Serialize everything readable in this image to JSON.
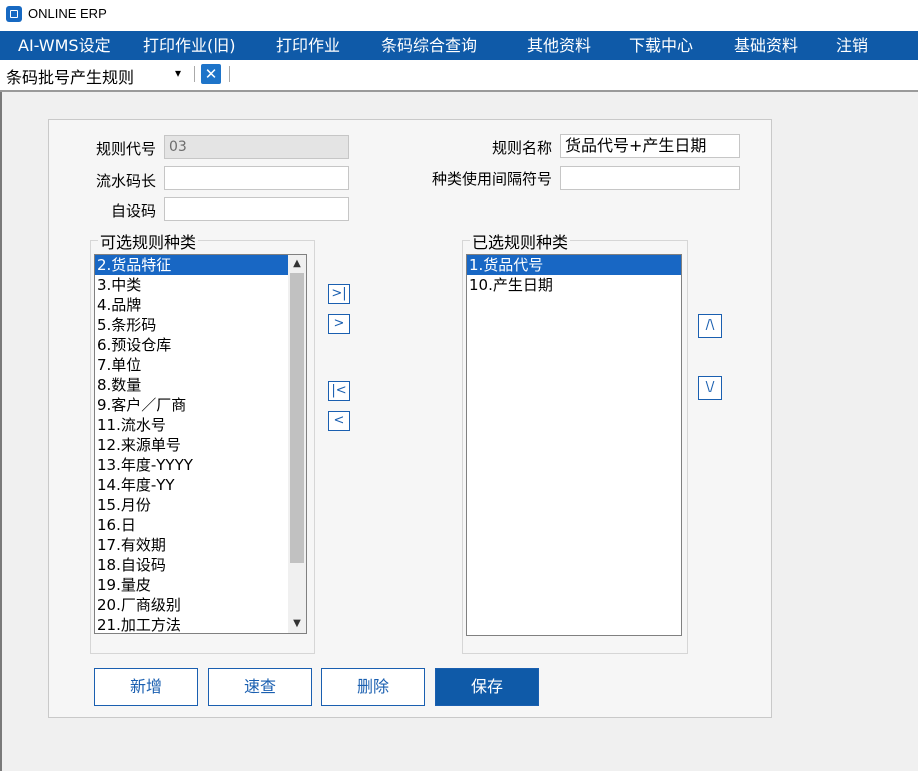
{
  "app": {
    "title": "ONLINE ERP"
  },
  "menu": [
    {
      "label": "AI-WMS设定"
    },
    {
      "label": "打印作业(旧)"
    },
    {
      "label": "打印作业"
    },
    {
      "label": "条码综合查询"
    },
    {
      "label": "其他资料"
    },
    {
      "label": "下载中心"
    },
    {
      "label": "基础资料"
    },
    {
      "label": "注销"
    }
  ],
  "tab": {
    "label": "条码批号产生规则",
    "caret": "▾",
    "close": "✕"
  },
  "form": {
    "rule_code_label": "规则代号",
    "rule_code_value": "03",
    "rule_name_label": "规则名称",
    "rule_name_value": "货品代号+产生日期",
    "serial_len_label": "流水码长",
    "serial_len_value": "",
    "separator_label": "种类使用间隔符号",
    "separator_value": "",
    "custom_code_label": "自设码",
    "custom_code_value": ""
  },
  "available": {
    "title": "可选规则种类",
    "items": [
      "2.货品特征",
      "3.中类",
      "4.品牌",
      "5.条形码",
      "6.预设仓库",
      "7.单位",
      "8.数量",
      "9.客户／厂商",
      "11.流水号",
      "12.来源单号",
      "13.年度-YYYY",
      "14.年度-YY",
      "15.月份",
      "16.日",
      "17.有效期",
      "18.自设码",
      "19.量皮",
      "20.厂商级别",
      "21.加工方法"
    ],
    "selected_index": 0
  },
  "selected": {
    "title": "已选规则种类",
    "items": [
      "1.货品代号",
      "10.产生日期"
    ],
    "selected_index": 0
  },
  "move_buttons": {
    "add_all": ">|",
    "add": ">",
    "remove_all": "|<",
    "remove": "<",
    "up": "/\\",
    "down": "\\/"
  },
  "actions": {
    "new": "新增",
    "quick": "速查",
    "delete": "删除",
    "save": "保存"
  },
  "colors": {
    "menu_bg": "#0f5aa8",
    "accent": "#1867c4"
  }
}
